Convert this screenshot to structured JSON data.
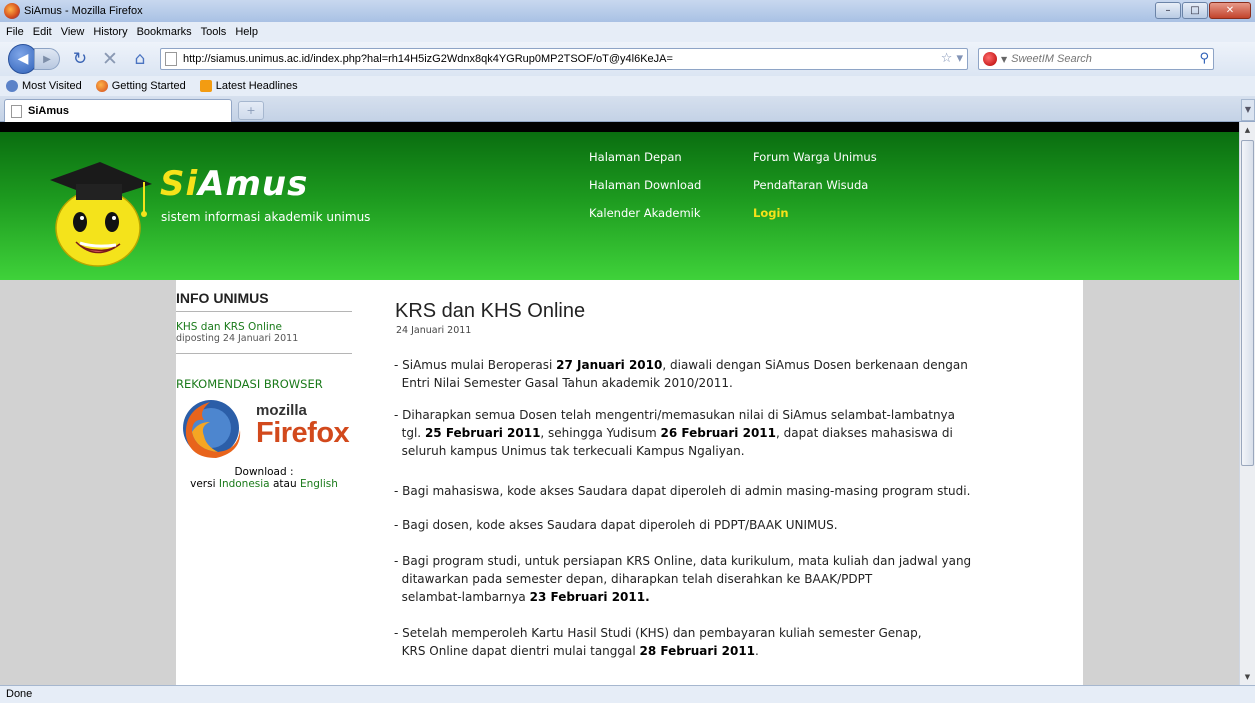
{
  "window": {
    "title": "SiAmus - Mozilla Firefox"
  },
  "menu": [
    "File",
    "Edit",
    "View",
    "History",
    "Bookmarks",
    "Tools",
    "Help"
  ],
  "navbar": {
    "url": "http://siamus.unimus.ac.id/index.php?hal=rh14H5izG2Wdnx8qk4YGRup0MP2TSOF/oT@y4l6KeJA=",
    "search_placeholder": "SweetIM Search"
  },
  "bookmarks": [
    "Most Visited",
    "Getting Started",
    "Latest Headlines"
  ],
  "tab": {
    "label": "SiAmus"
  },
  "site": {
    "brand_si": "Si",
    "brand_rest": "Amus",
    "tagline": "sistem informasi akademik unimus",
    "menu": {
      "halaman_depan": "Halaman Depan",
      "halaman_download": "Halaman Download",
      "kalender": "Kalender Akademik",
      "forum": "Forum Warga Unimus",
      "wisuda": "Pendaftaran Wisuda",
      "login": "Login"
    }
  },
  "sidebar": {
    "info_title": "INFO UNIMUS",
    "news_link": "KHS dan KRS Online",
    "news_date": "diposting 24 Januari 2011",
    "rekomendasi": "REKOMENDASI BROWSER",
    "ff_mozilla": "mozilla",
    "ff_firefox": "Firefox",
    "download_label": "Download :",
    "versi_prefix": "versi",
    "link_indonesia": "Indonesia",
    "atau": "atau",
    "link_english": "English"
  },
  "article": {
    "title": "KRS dan KHS Online",
    "date": "24 Januari 2011",
    "p1_a": "- SiAmus mulai Beroperasi ",
    "p1_b": "27 Januari 2010",
    "p1_c": ", diawali dengan SiAmus Dosen berkenaan dengan",
    "p1_d": "Entri Nilai Semester Gasal Tahun akademik 2010/2011.",
    "p2_a": "- Diharapkan semua Dosen telah mengentri/memasukan nilai di SiAmus selambat-lambatnya",
    "p2_b": "tgl. ",
    "p2_c": "25 Februari 2011",
    "p2_d": ", sehingga Yudisum ",
    "p2_e": "26 Februari 2011",
    "p2_f": ", dapat diakses mahasiswa di",
    "p2_g": "seluruh kampus Unimus tak terkecuali Kampus Ngaliyan.",
    "p3": "- Bagi mahasiswa, kode akses Saudara dapat diperoleh di admin masing-masing program studi.",
    "p4": "- Bagi dosen, kode akses Saudara dapat diperoleh di PDPT/BAAK UNIMUS.",
    "p5_a": "- Bagi program studi, untuk persiapan KRS Online, data kurikulum, mata kuliah dan jadwal yang",
    "p5_b": "ditawarkan pada semester depan, diharapkan telah diserahkan ke BAAK/PDPT",
    "p5_c": "selambat-lambarnya ",
    "p5_d": "23 Februari 2011.",
    "p6_a": "- Setelah memperoleh Kartu Hasil Studi (KHS) dan pembayaran kuliah semester Genap,",
    "p6_b": "KRS Online dapat dientri mulai tanggal ",
    "p6_c": "28 Februari 2011",
    "p6_d": "."
  },
  "status": {
    "text": "Done"
  }
}
